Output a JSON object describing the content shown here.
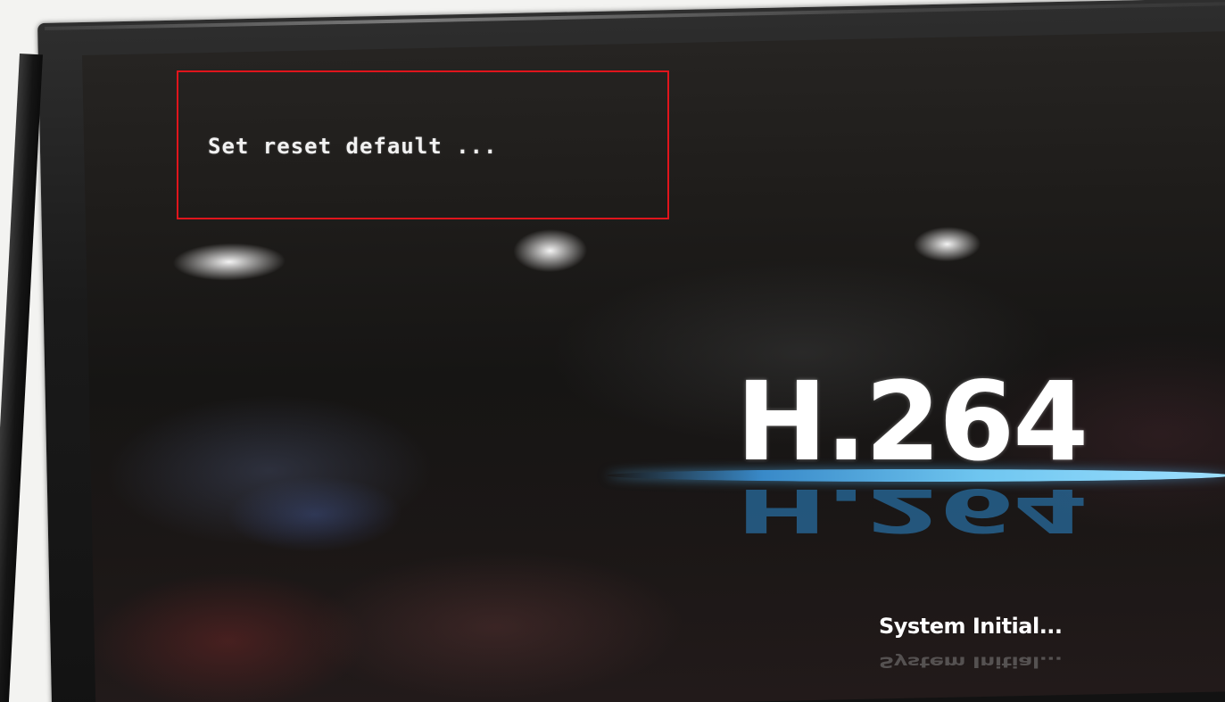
{
  "osd": {
    "message": "Set reset default ..."
  },
  "logo": {
    "text": "H.264"
  },
  "status": {
    "text": "System Initial..."
  },
  "colors": {
    "annotation_border": "#e0151c",
    "screen_background": "#1b1918",
    "logo_accent": "#6fc6f0",
    "text": "#ffffff"
  }
}
